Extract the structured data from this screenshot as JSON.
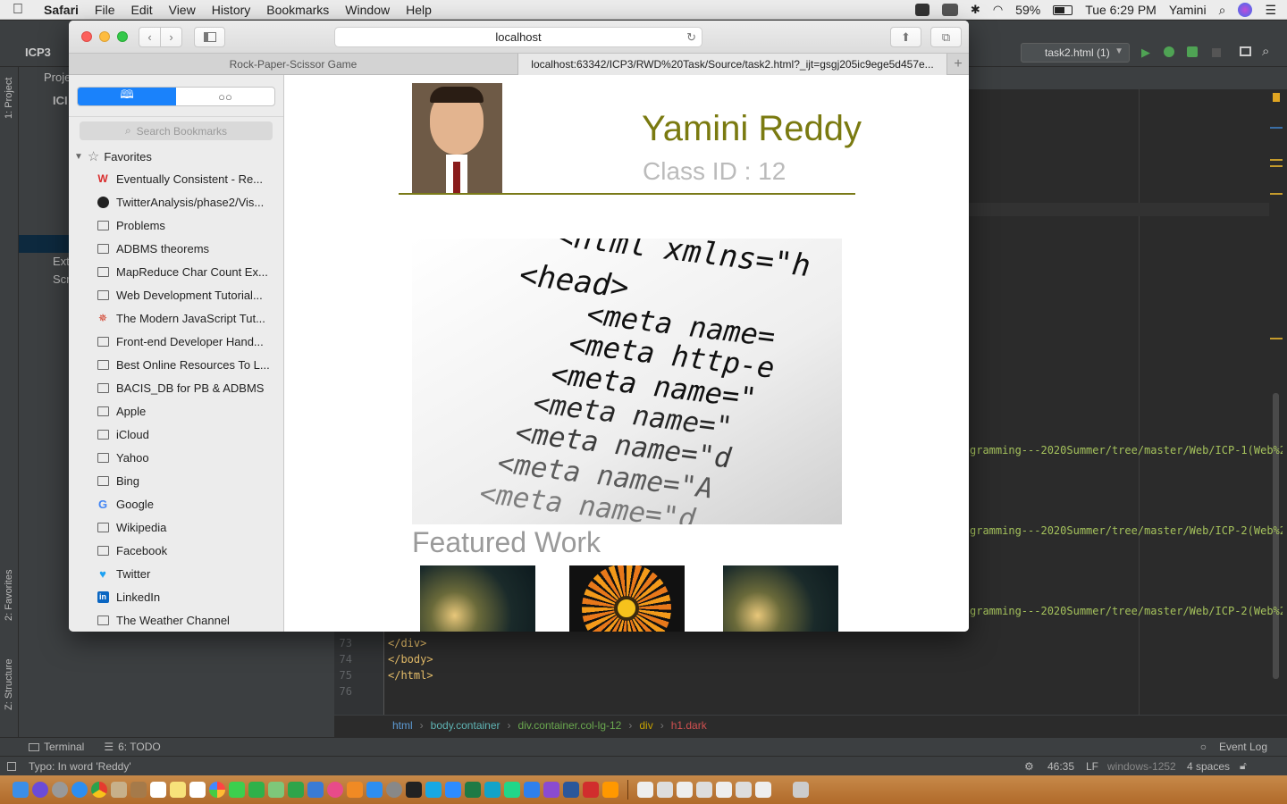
{
  "menubar": {
    "app_name": "Safari",
    "menus": [
      "File",
      "Edit",
      "View",
      "History",
      "Bookmarks",
      "Window",
      "Help"
    ],
    "battery": "59%",
    "clock": "Tue 6:29 PM",
    "user": "Yamini"
  },
  "ide": {
    "project_title": "ICP3",
    "project_panel_label": "Proje",
    "tree_label_1": "ICI",
    "tree_label_2": "Ext",
    "tree_label_3": "Scr",
    "run_config": "task2.html (1)",
    "side_tabs": {
      "project": "1: Project",
      "favorites": "2: Favorites",
      "structure": "Z: Structure"
    },
    "code_lines": [
      {
        "num": "73",
        "code": "</div>"
      },
      {
        "num": "74",
        "code": "</body>"
      },
      {
        "num": "75",
        "code": "</html>"
      },
      {
        "num": "76",
        "code": ""
      }
    ],
    "url_snippets": [
      "gramming---2020Summer/tree/master/Web/ICP-1(Web%20",
      "gramming---2020Summer/tree/master/Web/ICP-2(Web%20",
      "gramming---2020Summer/tree/master/Web/ICP-2(Web%20"
    ],
    "breadcrumbs": [
      "html",
      "body.container",
      "div.container.col-lg-12",
      "div",
      "h1.dark"
    ],
    "bottom_tools": {
      "terminal": "Terminal",
      "todo": "6: TODO",
      "event_log": "Event Log"
    },
    "status": {
      "message": "Typo: In word 'Reddy'",
      "position": "46:35",
      "line_sep": "LF",
      "encoding": "windows-1252",
      "indent": "4 spaces"
    }
  },
  "safari": {
    "address": "localhost",
    "tabs": [
      {
        "title": "Rock-Paper-Scissor Game"
      },
      {
        "title": "localhost:63342/ICP3/RWD%20Task/Source/task2.html?_ijt=gsgj205ic9ege5d457e..."
      }
    ],
    "sidebar": {
      "search_placeholder": "Search Bookmarks",
      "favorites_label": "Favorites",
      "bookmarks": [
        {
          "label": "Eventually Consistent - Re...",
          "icon": "w-icon"
        },
        {
          "label": "TwitterAnalysis/phase2/Vis...",
          "icon": "github-icon"
        },
        {
          "label": "Problems",
          "icon": "book-icon"
        },
        {
          "label": "ADBMS theorems",
          "icon": "book-icon"
        },
        {
          "label": "MapReduce Char Count Ex...",
          "icon": "book-icon"
        },
        {
          "label": "Web Development Tutorial...",
          "icon": "book-icon"
        },
        {
          "label": "The Modern JavaScript Tut...",
          "icon": "javascript-icon"
        },
        {
          "label": "Front-end Developer Hand...",
          "icon": "book-icon"
        },
        {
          "label": "Best Online Resources To L...",
          "icon": "book-icon"
        },
        {
          "label": "BACIS_DB for PB & ADBMS",
          "icon": "book-icon"
        },
        {
          "label": "Apple",
          "icon": "book-icon"
        },
        {
          "label": "iCloud",
          "icon": "book-icon"
        },
        {
          "label": "Yahoo",
          "icon": "book-icon"
        },
        {
          "label": "Bing",
          "icon": "book-icon"
        },
        {
          "label": "Google",
          "icon": "google-icon"
        },
        {
          "label": "Wikipedia",
          "icon": "book-icon"
        },
        {
          "label": "Facebook",
          "icon": "book-icon"
        },
        {
          "label": "Twitter",
          "icon": "twitter-icon"
        },
        {
          "label": "LinkedIn",
          "icon": "linkedin-icon"
        },
        {
          "label": "The Weather Channel",
          "icon": "book-icon"
        }
      ]
    },
    "page": {
      "name": "Yamini Reddy",
      "class_id": "Class ID : 12",
      "featured_heading": "Featured Work",
      "code_image_lines": [
        "<html xmlns=\"h",
        "<head>",
        "<meta name=",
        "<meta http-e",
        "<meta name=\"",
        "<meta name=\"",
        "<meta name=\"d",
        "<meta name=\"A",
        "<meta name=\"d"
      ]
    }
  },
  "colors": {
    "accent_blue": "#1a82fb",
    "name_olive": "#7a7a10",
    "muted_gray": "#bbbbbb",
    "ide_bg": "#2b2b2b"
  }
}
